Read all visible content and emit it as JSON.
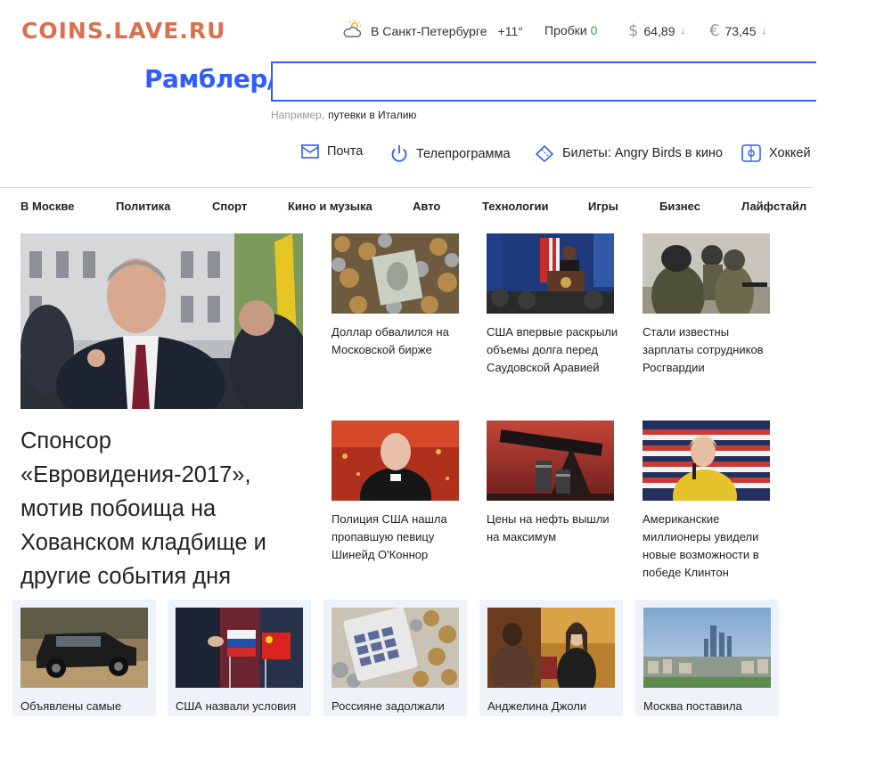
{
  "watermark": "COINS.LAVE.RU",
  "topbar": {
    "weather_city": "В Санкт-Петербурге",
    "weather_temp": "+11°",
    "traffic_label": "Пробки",
    "traffic_value": "0",
    "usd_symbol": "$",
    "usd_value": "64,89",
    "eur_symbol": "€",
    "eur_value": "73,45",
    "down_arrow": "↓"
  },
  "logo": "Рамблер/",
  "search": {
    "value": "",
    "hint_prefix": "Например,",
    "hint_example": "путевки в Италию"
  },
  "quick_links": [
    {
      "label": "Почта",
      "icon": "mail-icon"
    },
    {
      "label": "Телепрограмма",
      "icon": "power-icon"
    },
    {
      "label": "Билеты: Angry Birds в кино",
      "icon": "ticket-icon"
    },
    {
      "label": "Хоккей",
      "icon": "puck-icon"
    }
  ],
  "nav": [
    "В Москве",
    "Политика",
    "Спорт",
    "Кино и музыка",
    "Авто",
    "Технологии",
    "Игры",
    "Бизнес",
    "Лайфстайл"
  ],
  "featured": {
    "title": "Спонсор «Евровидения-2017», мотив побоища на Хованском кладбище и другие события дня"
  },
  "news": [
    {
      "title": "Доллар обвалился на Московской бирже"
    },
    {
      "title": "США впервые раскрыли объемы долга перед Саудовской Аравией"
    },
    {
      "title": "Стали известны зарплаты сотрудников Росгвардии"
    },
    {
      "title": "Полиция США нашла пропавшую певицу Шинейд О'Коннор"
    },
    {
      "title": "Цены на нефть вышли на максимум"
    },
    {
      "title": "Американские миллионеры увидели новые возможности в победе Клинтон"
    }
  ],
  "bottom": [
    {
      "title": "Объявлены самые"
    },
    {
      "title": "США назвали условия"
    },
    {
      "title": "Россияне задолжали"
    },
    {
      "title": "Анджелина Джоли"
    },
    {
      "title": "Москва поставила"
    }
  ],
  "colors": {
    "brand_blue": "#315efb",
    "watermark": "#d9714f",
    "traffic_green": "#3ea34a",
    "down_red": "#e53935",
    "card_bg": "#eef3fa"
  }
}
